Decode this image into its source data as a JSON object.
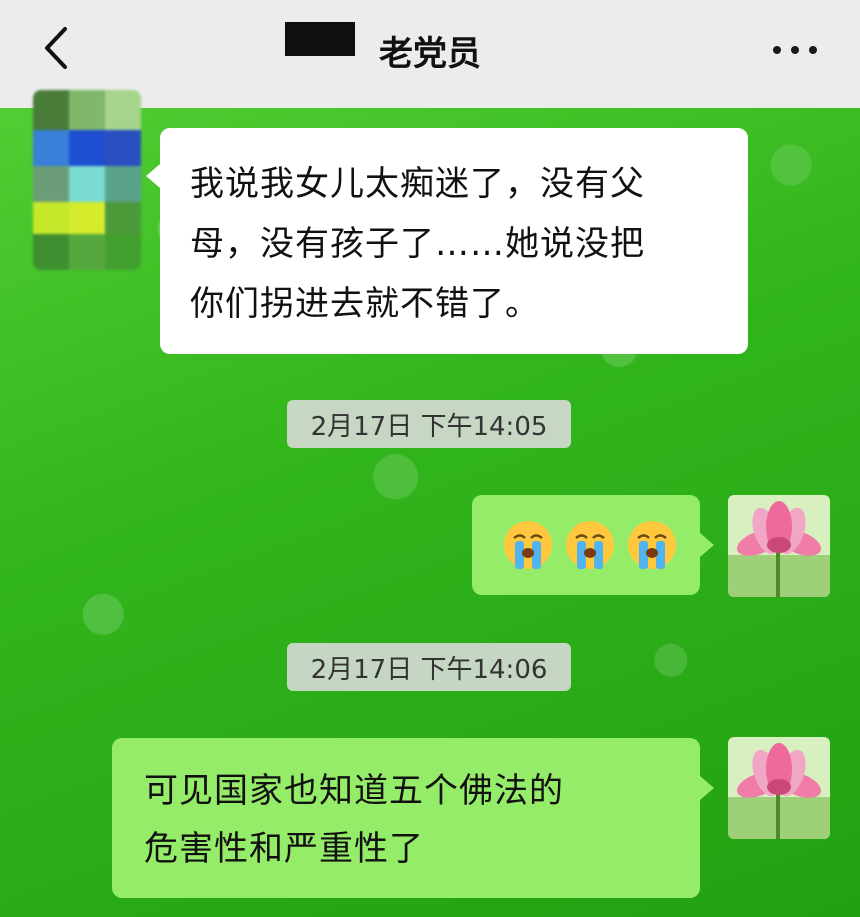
{
  "header": {
    "title": "老党员",
    "back_icon": "chevron-left-icon",
    "more_icon": "more-dots-icon"
  },
  "messages": [
    {
      "side": "left",
      "sender_avatar": "pixelated-avatar",
      "lines": [
        "我说我女儿太痴迷了，没有父",
        "母，没有孩子了……她说没把",
        "你们拐进去就不错了。"
      ]
    },
    {
      "type": "timestamp",
      "text": "2月17日 下午14:05"
    },
    {
      "side": "right",
      "sender_avatar": "lotus-flower-avatar",
      "emojis": [
        "loudly-crying-face-icon",
        "loudly-crying-face-icon",
        "loudly-crying-face-icon"
      ]
    },
    {
      "type": "timestamp",
      "text": "2月17日 下午14:06"
    },
    {
      "side": "right",
      "sender_avatar": "lotus-flower-avatar",
      "lines": [
        "可见国家也知道五个佛法的",
        "危害性和严重性了"
      ]
    }
  ],
  "colors": {
    "topbar": "#ececec",
    "bubble_incoming": "#ffffff",
    "bubble_outgoing": "#95ec69",
    "background_green": "#32b61c",
    "timestamp_bg": "#dcdcdc"
  }
}
